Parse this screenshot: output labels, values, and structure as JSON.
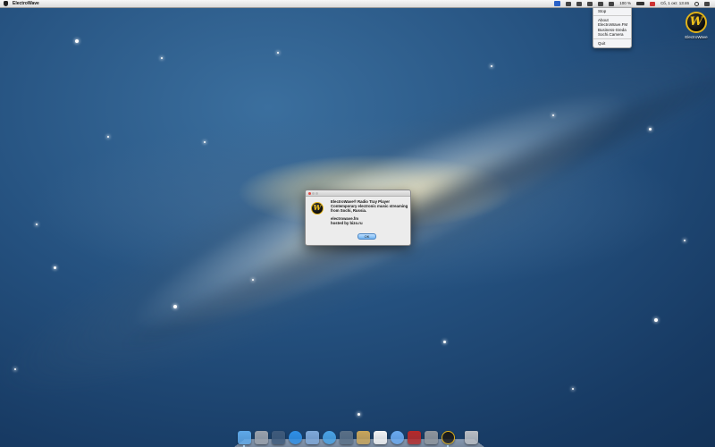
{
  "menubar": {
    "app_name": "ElectroWave",
    "status_clock": "Сб, 1 окт.  13:46",
    "battery_text": "100 %"
  },
  "tray_menu": {
    "items": [
      {
        "label": "Stop"
      },
      {
        "label": "About"
      },
      {
        "label": "ElectroWave.FM"
      },
      {
        "label": "Business-Sreda"
      },
      {
        "label": "Sochi.Camera"
      },
      {
        "label": "Quit"
      }
    ]
  },
  "desktop_icon": {
    "label": "ElectroWave",
    "logo_glyph": "W"
  },
  "about_dialog": {
    "line1": "ElectroWave® Radio Tray Player",
    "line2": "Contemporary electronic music streaming",
    "line3": "from Sochi, Russia.",
    "line4": "electrowave.fm",
    "line5": "hosted by bizo.ru",
    "ok_label": "OK",
    "logo_glyph": "W"
  },
  "dock": {
    "apps": [
      {
        "name": "finder",
        "color": "#5fa8e8"
      },
      {
        "name": "launchpad",
        "color": "#9aa1ab"
      },
      {
        "name": "mission-control",
        "color": "#3f5a7a"
      },
      {
        "name": "app-store",
        "color": "#2f8fe6"
      },
      {
        "name": "mail",
        "color": "#7fa8d8"
      },
      {
        "name": "safari",
        "color": "#4aa2e4"
      },
      {
        "name": "facetime",
        "color": "#5a6f86"
      },
      {
        "name": "notes",
        "color": "#c9a55a"
      },
      {
        "name": "calendar",
        "color": "#f4f4f4"
      },
      {
        "name": "itunes",
        "color": "#6aa9ef"
      },
      {
        "name": "photo-booth",
        "color": "#b52a2a"
      },
      {
        "name": "system-preferences",
        "color": "#8f959c"
      },
      {
        "name": "electrowave",
        "color": "#1a1a1a"
      },
      {
        "name": "trash",
        "color": "#b9bdc3"
      }
    ]
  }
}
